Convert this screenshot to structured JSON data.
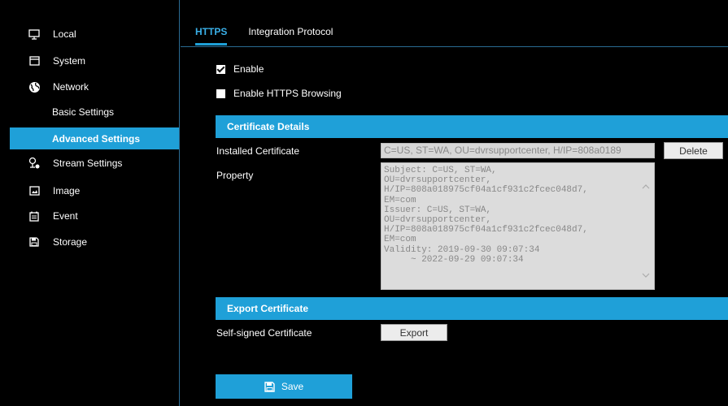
{
  "sidebar": {
    "items": [
      {
        "label": "Local",
        "icon": "monitor-icon"
      },
      {
        "label": "System",
        "icon": "window-icon"
      },
      {
        "label": "Network",
        "icon": "globe-icon"
      },
      {
        "label": "Basic Settings",
        "icon": ""
      },
      {
        "label": "Advanced Settings",
        "icon": "",
        "active": true
      },
      {
        "label": "Stream Settings",
        "icon": "camera-stream-icon"
      },
      {
        "label": "Image",
        "icon": "image-icon"
      },
      {
        "label": "Event",
        "icon": "calendar-icon"
      },
      {
        "label": "Storage",
        "icon": "floppy-icon"
      }
    ],
    "accent": "#1fa0d8"
  },
  "tabs": [
    {
      "label": "HTTPS",
      "active": true
    },
    {
      "label": "Integration Protocol"
    }
  ],
  "form": {
    "enable_label": "Enable",
    "enable_checked": true,
    "https_browsing_label": "Enable HTTPS Browsing",
    "https_browsing_checked": false,
    "cert_details_header": "Certificate Details",
    "installed_cert_label": "Installed Certificate",
    "installed_cert_value": "C=US, ST=WA, OU=dvrsupportcenter, H/IP=808a0189",
    "delete_label": "Delete",
    "property_label": "Property",
    "property_text": "Subject: C=US, ST=WA,\nOU=dvrsupportcenter,\nH/IP=808a018975cf04a1cf931c2fcec048d7,\nEM=com\nIssuer: C=US, ST=WA,\nOU=dvrsupportcenter,\nH/IP=808a018975cf04a1cf931c2fcec048d7,\nEM=com\nValidity: 2019-09-30 09:07:34\n     ~ 2022-09-29 09:07:34",
    "export_header": "Export Certificate",
    "self_signed_label": "Self-signed Certificate",
    "export_label": "Export",
    "save_label": "Save"
  }
}
